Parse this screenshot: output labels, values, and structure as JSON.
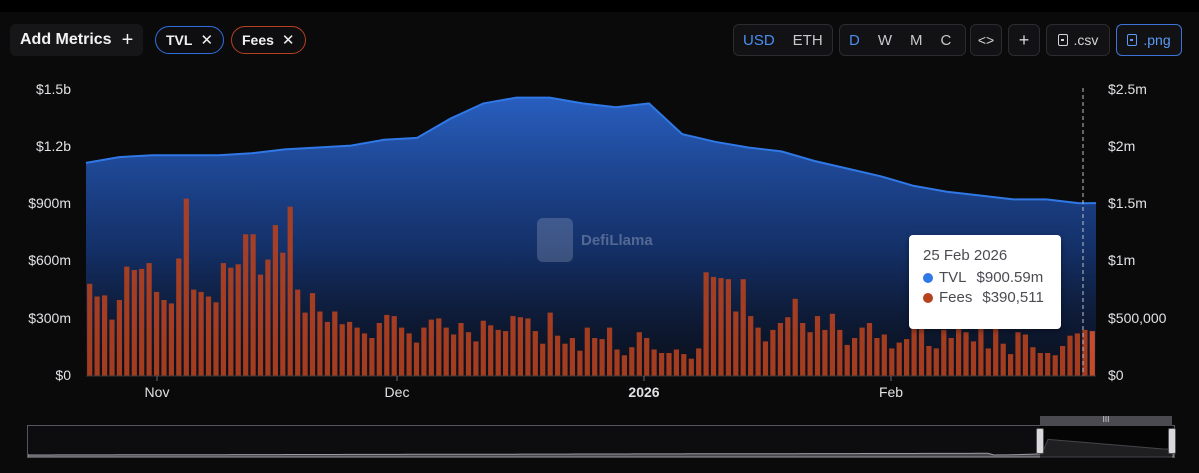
{
  "toolbar": {
    "add_metrics_label": "Add Metrics",
    "add_icon": "+",
    "pills": [
      {
        "label": "TVL",
        "close": "✕",
        "color": "#2f6fd9"
      },
      {
        "label": "Fees",
        "close": "✕",
        "color": "#b5411f"
      }
    ],
    "currency_options": [
      "USD",
      "ETH"
    ],
    "currency_selected": "USD",
    "period_options": [
      "D",
      "W",
      "M",
      "C"
    ],
    "period_selected": "D",
    "embed_icon": "<>",
    "add_chart_icon": "+",
    "csv_label": ".csv",
    "png_label": ".png"
  },
  "watermark": "DefiLlama",
  "tooltip": {
    "date": "25 Feb 2026",
    "rows": [
      {
        "name": "TVL",
        "value": "$900.59m",
        "color": "#2f78e6"
      },
      {
        "name": "Fees",
        "value": "$390,511",
        "color": "#b5411f"
      }
    ]
  },
  "slider": {
    "grip": "III"
  },
  "chart_data": {
    "type": "area",
    "title": "",
    "x_tick_labels": [
      "Nov",
      "Dec",
      "2026",
      "Feb"
    ],
    "x_range": [
      "2025-10-26",
      "2026-02-25"
    ],
    "y_left": {
      "ticks": [
        "$0",
        "$300m",
        "$600m",
        "$900m",
        "$1.2b",
        "$1.5b"
      ],
      "range": [
        0,
        1500000000
      ]
    },
    "y_right": {
      "ticks": [
        "$0",
        "$500,000",
        "$1m",
        "$1.5m",
        "$2m",
        "$2.5m"
      ],
      "range": [
        0,
        2500000
      ]
    },
    "grid": false,
    "series": [
      {
        "name": "TVL",
        "kind": "area",
        "axis": "left",
        "color": "#2f78e6",
        "unit": "USD",
        "x": [
          "2025-10-26",
          "2025-10-30",
          "2025-11-03",
          "2025-11-07",
          "2025-11-11",
          "2025-11-15",
          "2025-11-19",
          "2025-11-23",
          "2025-11-27",
          "2025-12-01",
          "2025-12-05",
          "2025-12-09",
          "2025-12-13",
          "2025-12-17",
          "2025-12-21",
          "2025-12-25",
          "2025-12-29",
          "2026-01-02",
          "2026-01-06",
          "2026-01-10",
          "2026-01-14",
          "2026-01-18",
          "2026-01-22",
          "2026-01-26",
          "2026-01-30",
          "2026-02-03",
          "2026-02-07",
          "2026-02-11",
          "2026-02-15",
          "2026-02-19",
          "2026-02-23",
          "2026-02-25"
        ],
        "values": [
          1110000000,
          1140000000,
          1150000000,
          1150000000,
          1150000000,
          1160000000,
          1180000000,
          1190000000,
          1200000000,
          1230000000,
          1240000000,
          1340000000,
          1420000000,
          1450000000,
          1450000000,
          1420000000,
          1400000000,
          1420000000,
          1260000000,
          1220000000,
          1190000000,
          1170000000,
          1120000000,
          1080000000,
          1040000000,
          990000000,
          960000000,
          940000000,
          920000000,
          920000000,
          900000000,
          900590000
        ]
      },
      {
        "name": "Fees",
        "kind": "bar",
        "axis": "right",
        "color": "#b5411f",
        "unit": "USD",
        "values": [
          800000,
          690000,
          700000,
          490000,
          660000,
          950000,
          920000,
          930000,
          980000,
          730000,
          660000,
          630000,
          1020000,
          1540000,
          750000,
          730000,
          690000,
          640000,
          980000,
          940000,
          970000,
          1230000,
          1230000,
          880000,
          1010000,
          1310000,
          1070000,
          1470000,
          750000,
          550000,
          720000,
          560000,
          470000,
          560000,
          450000,
          470000,
          420000,
          370000,
          330000,
          460000,
          530000,
          520000,
          420000,
          370000,
          290000,
          420000,
          490000,
          500000,
          420000,
          360000,
          460000,
          380000,
          300000,
          480000,
          440000,
          400000,
          390000,
          520000,
          510000,
          500000,
          390000,
          280000,
          550000,
          350000,
          280000,
          330000,
          220000,
          420000,
          330000,
          320000,
          420000,
          230000,
          180000,
          250000,
          380000,
          330000,
          230000,
          200000,
          200000,
          230000,
          190000,
          150000,
          240000,
          900000,
          860000,
          850000,
          840000,
          560000,
          840000,
          520000,
          420000,
          300000,
          400000,
          460000,
          510000,
          670000,
          460000,
          380000,
          520000,
          400000,
          540000,
          400000,
          270000,
          330000,
          420000,
          460000,
          330000,
          360000,
          240000,
          290000,
          320000,
          430000,
          530000,
          260000,
          240000,
          400000,
          330000,
          760000,
          380000,
          300000,
          470000,
          240000,
          420000,
          280000,
          190000,
          380000,
          360000,
          250000,
          200000,
          200000,
          180000,
          260000,
          350000,
          370000,
          400000,
          390000
        ]
      }
    ]
  }
}
